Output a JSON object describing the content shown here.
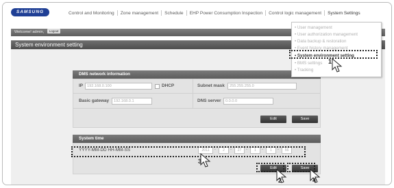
{
  "nav": {
    "logo": "SAMSUNG",
    "items": [
      {
        "label": "Control and Monitoring"
      },
      {
        "label": "Zone management"
      },
      {
        "label": "Schedule"
      },
      {
        "label": "EHP Power Consumption Inspection"
      },
      {
        "label": "Control logic management"
      },
      {
        "label": "System Settings"
      }
    ]
  },
  "welcome": {
    "text": "Welcome! admin,",
    "logout": "Logout"
  },
  "page_title": "System environment setting",
  "dms": {
    "title": "DMS network information",
    "ip_label": "IP",
    "ip_value": "192.168.0.100",
    "dhcp_label": "DHCP",
    "subnet_label": "Subnet mask",
    "subnet_value": "255.255.255.0",
    "gateway_label": "Basic gateway",
    "gateway_value": "192.168.0.1",
    "dns_label": "DNS server",
    "dns_value": "0.0.0.0",
    "edit": "Edit",
    "save": "Save"
  },
  "system_time": {
    "title": "System time",
    "format_label": "YYYY-MM-DD HH-MM-SS",
    "values": [
      "2011",
      "2",
      "27",
      "1",
      "1",
      "56"
    ],
    "edit": "Edit",
    "save": "Save"
  },
  "dropdown": {
    "items": [
      {
        "label": "User management"
      },
      {
        "label": "User authorization management"
      },
      {
        "label": "Data backup & restoration"
      },
      {
        "label": "Event history management"
      },
      {
        "label": "System environment setting"
      },
      {
        "label": "BMS settings"
      },
      {
        "label": "Tracking"
      }
    ]
  },
  "callouts": {
    "n1": "1",
    "n2": "2",
    "n3": "3",
    "n4": "4"
  }
}
